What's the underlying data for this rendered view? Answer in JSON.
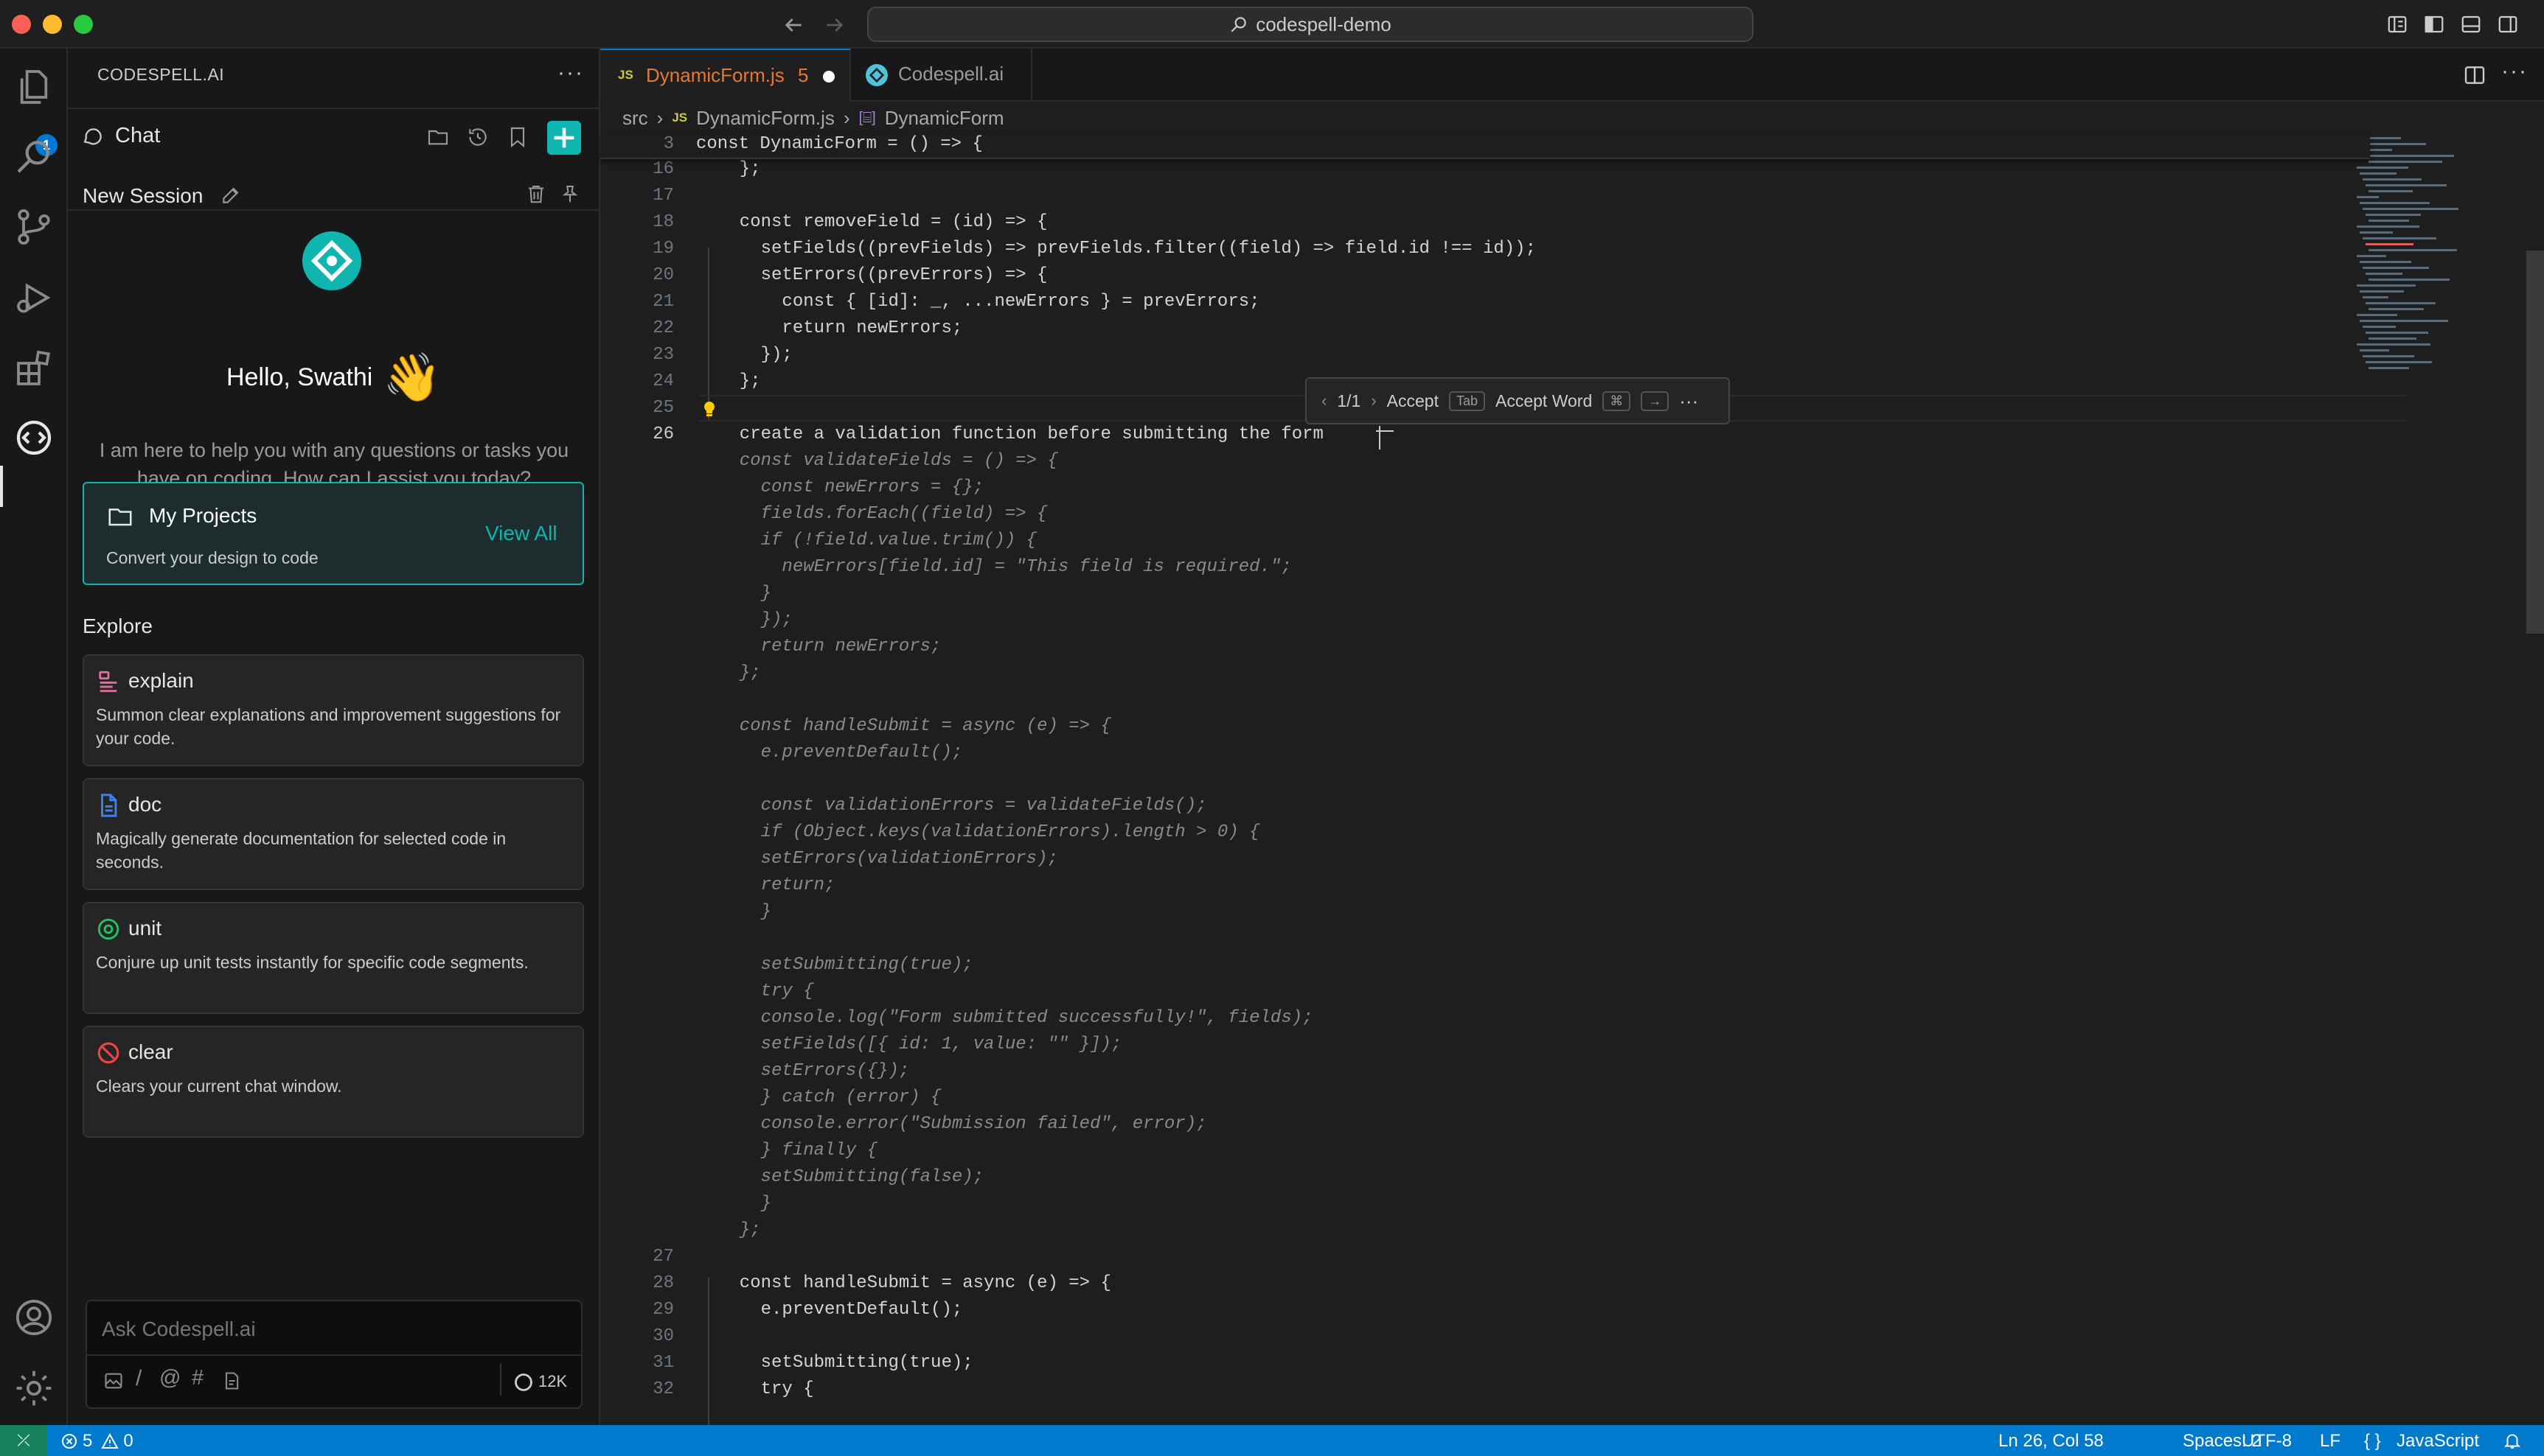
{
  "window": {
    "title": "codespell-demo"
  },
  "activity_bar": {
    "explorer_badge": "1"
  },
  "sidebar": {
    "header_title": "CODESPELL.AI",
    "chat_label": "Chat",
    "session_title": "New Session",
    "greeting": "Hello, Swathi",
    "wave_emoji": "👋",
    "intro": "I am here to help you with any questions or tasks you have on coding. How can I assist you today?",
    "projects": {
      "title": "My Projects",
      "subtitle": "Convert your design to code",
      "link": "View All"
    },
    "explore_title": "Explore",
    "explore_items": [
      {
        "title": "explain",
        "desc": "Summon clear explanations and improvement suggestions for your code.",
        "icon": "explain-icon"
      },
      {
        "title": "doc",
        "desc": "Magically generate documentation for selected code in seconds.",
        "icon": "doc-icon"
      },
      {
        "title": "unit",
        "desc": "Conjure up unit tests instantly for specific code segments.",
        "icon": "unit-icon"
      },
      {
        "title": "clear",
        "desc": "Clears your current chat window.",
        "icon": "clear-icon"
      }
    ],
    "input": {
      "placeholder": "Ask Codespell.ai",
      "token_count": "12K"
    }
  },
  "editor": {
    "tabs": [
      {
        "icon_label": "JS",
        "label": "DynamicForm.js",
        "problems": "5"
      },
      {
        "label": "Codespell.ai"
      }
    ],
    "breadcrumb": [
      "src",
      "JS",
      "DynamicForm.js",
      "DynamicForm"
    ],
    "sticky": {
      "number": "3",
      "text": "const DynamicForm = () => {"
    },
    "lines": [
      {
        "n": "16",
        "t": "  };"
      },
      {
        "n": "17",
        "t": ""
      },
      {
        "n": "18",
        "t": "  const removeField = (id) => {"
      },
      {
        "n": "19",
        "t": "    setFields((prevFields) => prevFields.filter((field) => field.id !== id));"
      },
      {
        "n": "20",
        "t": "    setErrors((prevErrors) => {"
      },
      {
        "n": "21",
        "t": "      const { [id]: _, ...newErrors } = prevErrors;"
      },
      {
        "n": "22",
        "t": "      return newErrors;"
      },
      {
        "n": "23",
        "t": "    });"
      },
      {
        "n": "24",
        "t": "  };"
      },
      {
        "n": "25",
        "t": ""
      },
      {
        "n": "26",
        "t": "  create a validation function before submitting the form"
      }
    ],
    "ghost_lines": [
      "  const validateFields = () => {",
      "    const newErrors = {};",
      "    fields.forEach((field) => {",
      "    if (!field.value.trim()) {",
      "      newErrors[field.id] = \"This field is required.\";",
      "    }",
      "    });",
      "    return newErrors;",
      "  };",
      "",
      "  const handleSubmit = async (e) => {",
      "    e.preventDefault();",
      "",
      "    const validationErrors = validateFields();",
      "    if (Object.keys(validationErrors).length > 0) {",
      "    setErrors(validationErrors);",
      "    return;",
      "    }",
      "",
      "    setSubmitting(true);",
      "    try {",
      "    console.log(\"Form submitted successfully!\", fields);",
      "    setFields([{ id: 1, value: \"\" }]);",
      "    setErrors({});",
      "    } catch (error) {",
      "    console.error(\"Submission failed\", error);",
      "    } finally {",
      "    setSubmitting(false);",
      "    }",
      "  };"
    ],
    "lines_after": [
      {
        "n": "27",
        "t": ""
      },
      {
        "n": "28",
        "t": "  const handleSubmit = async (e) => {"
      },
      {
        "n": "29",
        "t": "    e.preventDefault();"
      },
      {
        "n": "30",
        "t": ""
      },
      {
        "n": "31",
        "t": "    setSubmitting(true);"
      },
      {
        "n": "32",
        "t": "    try {"
      }
    ],
    "suggestion_widget": {
      "counter": "1/1",
      "accept": "Accept",
      "accept_key": "Tab",
      "accept_word": "Accept Word",
      "accept_word_key1": "⌘",
      "accept_word_key2": "→",
      "more": "···"
    }
  },
  "status_bar": {
    "errors": "5",
    "warnings": "0",
    "position": "Ln 26, Col 58",
    "spaces": "Spaces: 2",
    "encoding": "UTF-8",
    "eol": "LF",
    "language": "JavaScript"
  },
  "colors": {
    "accent": "#0078d4",
    "status_bar": "#007acc",
    "teal": "#0fb5ae",
    "tab_modified": "#e37933"
  }
}
